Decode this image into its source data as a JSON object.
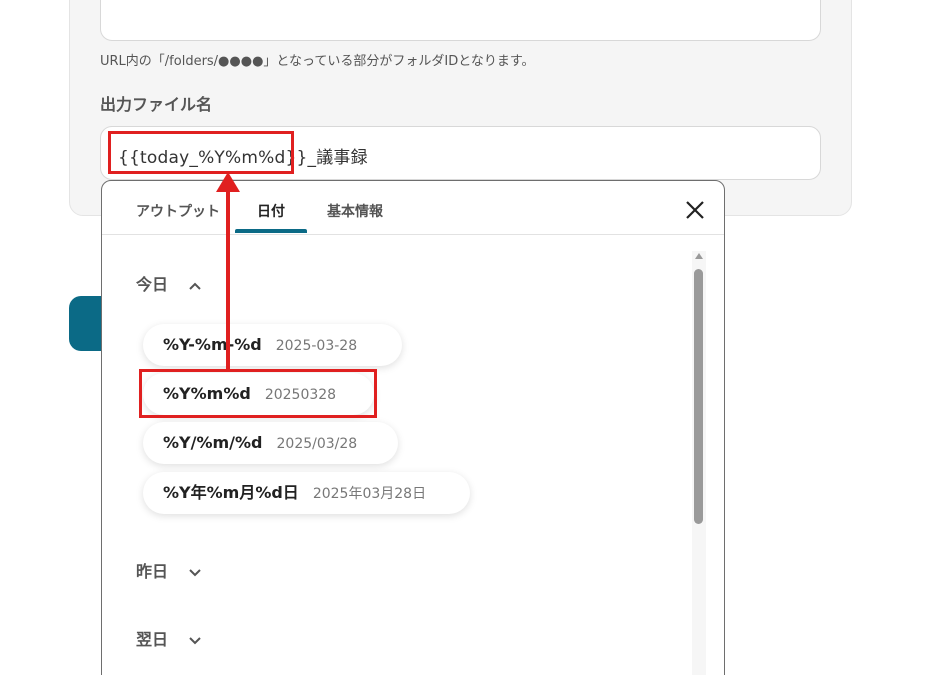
{
  "form": {
    "hint": "URL内の「/folders/●●●●」となっている部分がフォルダIDとなります。",
    "filename_label": "出力ファイル名",
    "filename_value": "{{today_%Y%m%d}}_議事録"
  },
  "dropdown": {
    "tabs": [
      {
        "label": "アウトプット",
        "active": false
      },
      {
        "label": "日付",
        "active": true
      },
      {
        "label": "基本情報",
        "active": false
      }
    ],
    "sections": [
      {
        "label": "今日",
        "expanded": true
      },
      {
        "label": "昨日",
        "expanded": false
      },
      {
        "label": "翌日",
        "expanded": false
      }
    ],
    "today_formats": [
      {
        "format": "%Y-%m-%d",
        "example": "2025-03-28"
      },
      {
        "format": "%Y%m%d",
        "example": "20250328"
      },
      {
        "format": "%Y/%m/%d",
        "example": "2025/03/28"
      },
      {
        "format": "%Y年%m月%d日",
        "example": "2025年03月28日"
      }
    ]
  },
  "colors": {
    "accent": "#0b6a86",
    "highlight": "#e02020"
  },
  "icons": [
    "close-icon",
    "chevron-up-icon",
    "chevron-down-icon"
  ]
}
